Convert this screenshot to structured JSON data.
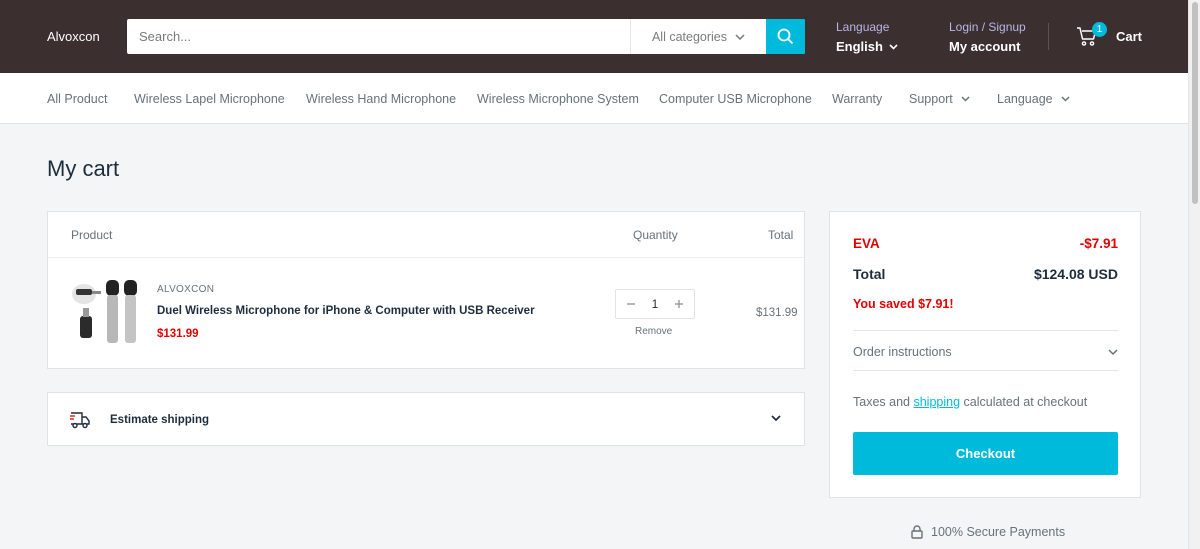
{
  "header": {
    "logo": "Alvoxcon",
    "search": {
      "placeholder": "Search...",
      "category": "All categories"
    },
    "language": {
      "label": "Language",
      "value": "English"
    },
    "account": {
      "label": "Login / Signup",
      "value": "My account"
    },
    "cart": {
      "count": "1",
      "label": "Cart"
    }
  },
  "nav": {
    "items": [
      {
        "label": "All Product"
      },
      {
        "label": "Wireless Lapel Microphone"
      },
      {
        "label": "Wireless Hand Microphone"
      },
      {
        "label": "Wireless Microphone System"
      },
      {
        "label": "Computer USB Microphone"
      },
      {
        "label": "Warranty"
      },
      {
        "label": "Support"
      },
      {
        "label": "Language"
      }
    ]
  },
  "page": {
    "title": "My cart"
  },
  "cart_table": {
    "headers": {
      "product": "Product",
      "quantity": "Quantity",
      "total": "Total"
    },
    "items": [
      {
        "brand": "ALVOXCON",
        "name": "Duel Wireless Microphone for iPhone & Computer with USB Receiver",
        "price": "$131.99",
        "quantity": "1",
        "remove_label": "Remove",
        "line_total": "$131.99"
      }
    ]
  },
  "shipping": {
    "label": "Estimate shipping"
  },
  "summary": {
    "discount_label": "EVA",
    "discount_value": "-$7.91",
    "total_label": "Total",
    "total_value": "$124.08 USD",
    "saved": "You saved $7.91!",
    "order_instructions": "Order instructions",
    "taxes_prefix": "Taxes and ",
    "taxes_link": "shipping",
    "taxes_suffix": " calculated at checkout",
    "checkout_label": "Checkout"
  },
  "footer": {
    "secure": "100% Secure Payments"
  },
  "colors": {
    "header_bg": "#3b2f2f",
    "accent": "#00badb",
    "sale": "#e00000"
  }
}
